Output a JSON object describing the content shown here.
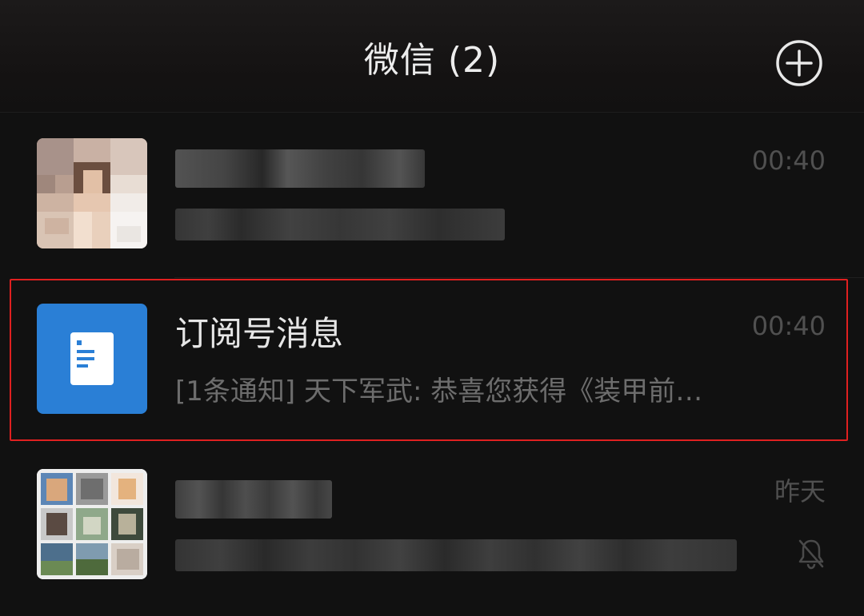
{
  "header": {
    "title": "微信 (2)",
    "add_icon": "plus-circle-icon"
  },
  "chats": [
    {
      "name": "",
      "preview": "",
      "time": "00:40",
      "avatar": "blurred-photo"
    },
    {
      "name": "订阅号消息",
      "preview": "[1条通知] 天下军武: 恭喜您获得《装甲前…",
      "time": "00:40",
      "avatar": "subscription-document-icon"
    },
    {
      "name": "",
      "preview": "",
      "time": "昨天",
      "avatar": "group-photo-grid",
      "muted_icon": "bell-muted-icon"
    }
  ],
  "colors": {
    "background": "#111111",
    "subscription_blue": "#2a7fd6",
    "highlight_red": "#e02020"
  }
}
